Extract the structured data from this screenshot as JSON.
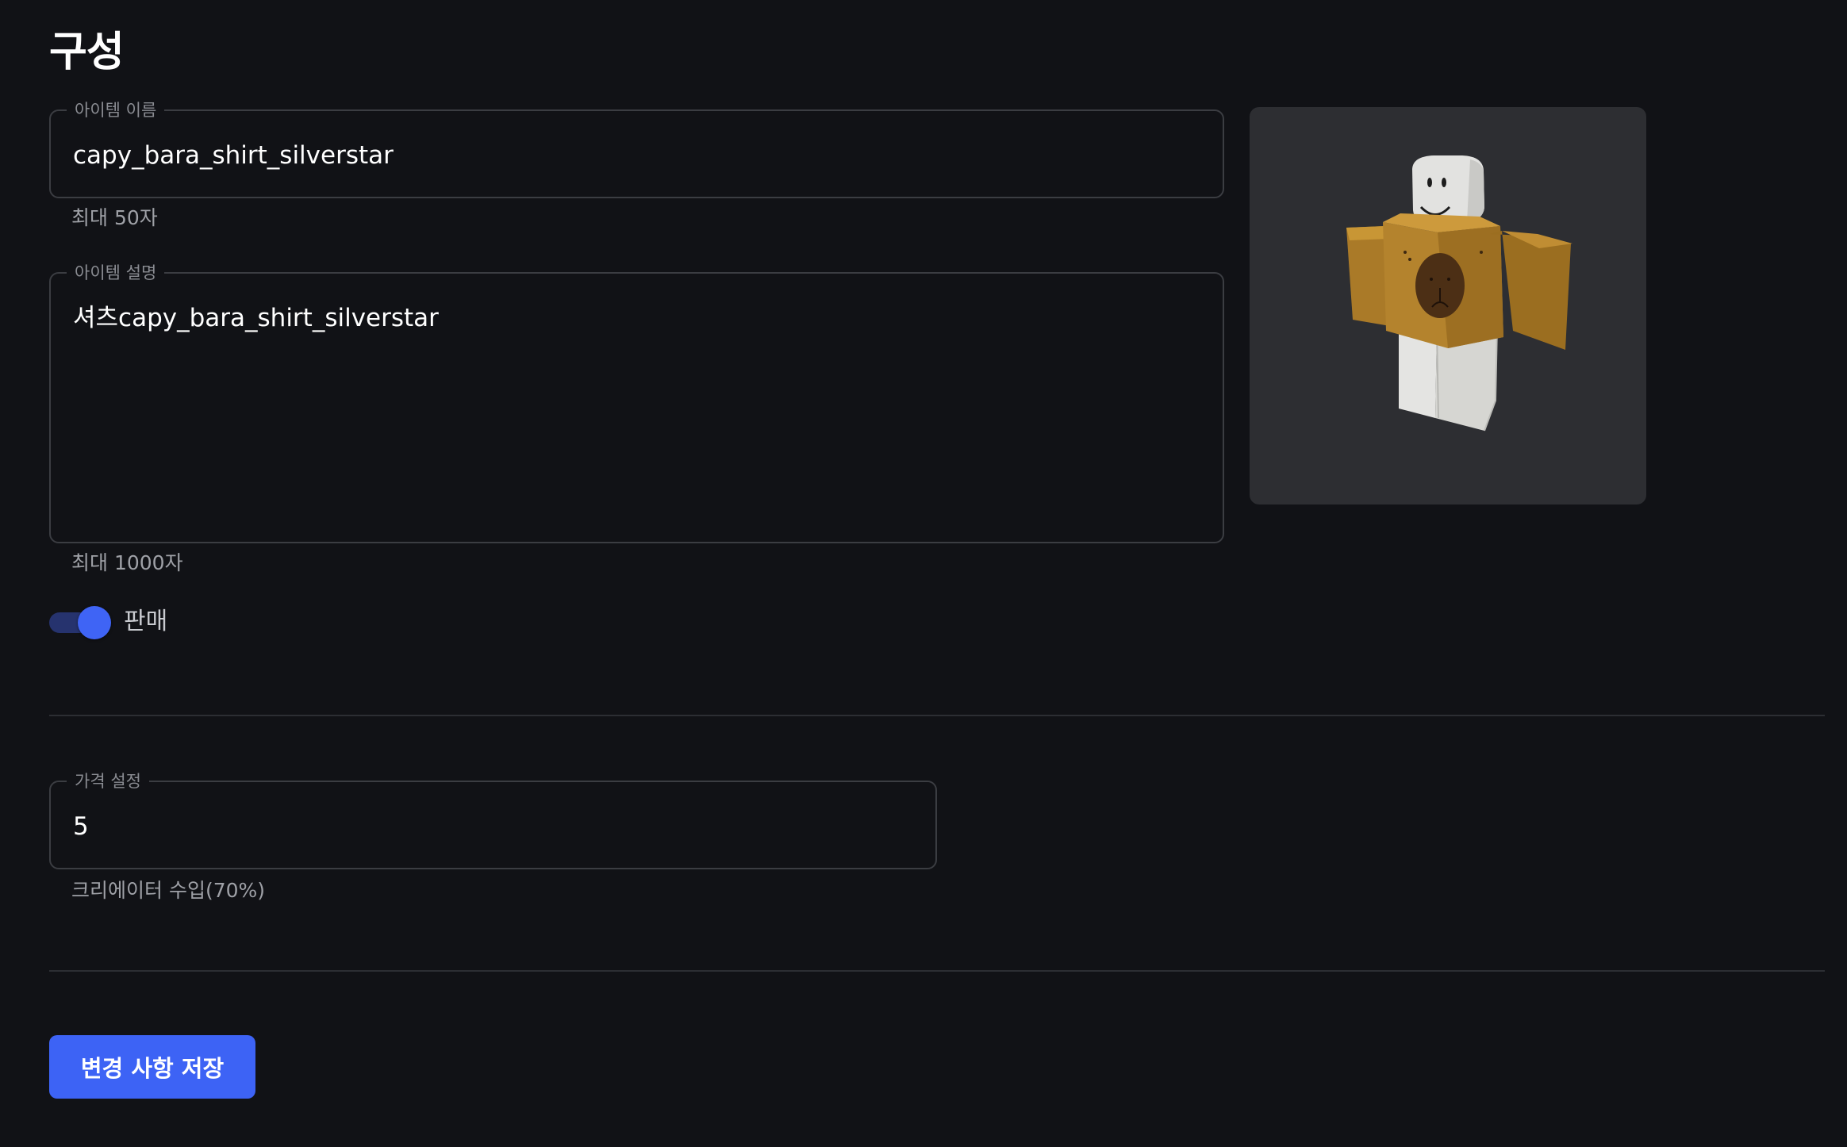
{
  "page": {
    "title": "구성"
  },
  "name_field": {
    "legend": "아이템 이름",
    "value": "capy_bara_shirt_silverstar",
    "helper": "최대 50자"
  },
  "description_field": {
    "legend": "아이템 설명",
    "value": "셔츠capy_bara_shirt_silverstar",
    "helper": "최대 1000자"
  },
  "preview": {
    "icon": "avatar-shirt-preview-image"
  },
  "sale_toggle": {
    "label": "판매",
    "checked": true
  },
  "price_field": {
    "legend": "가격 설정",
    "value": "5",
    "helper": "크리에이터 수입(70%)"
  },
  "save_button": {
    "label": "변경 사항 저장"
  },
  "colors": {
    "background": "#111216",
    "accent": "#3d63f5",
    "border": "#3b3d42",
    "preview_background": "#2d2e32"
  }
}
